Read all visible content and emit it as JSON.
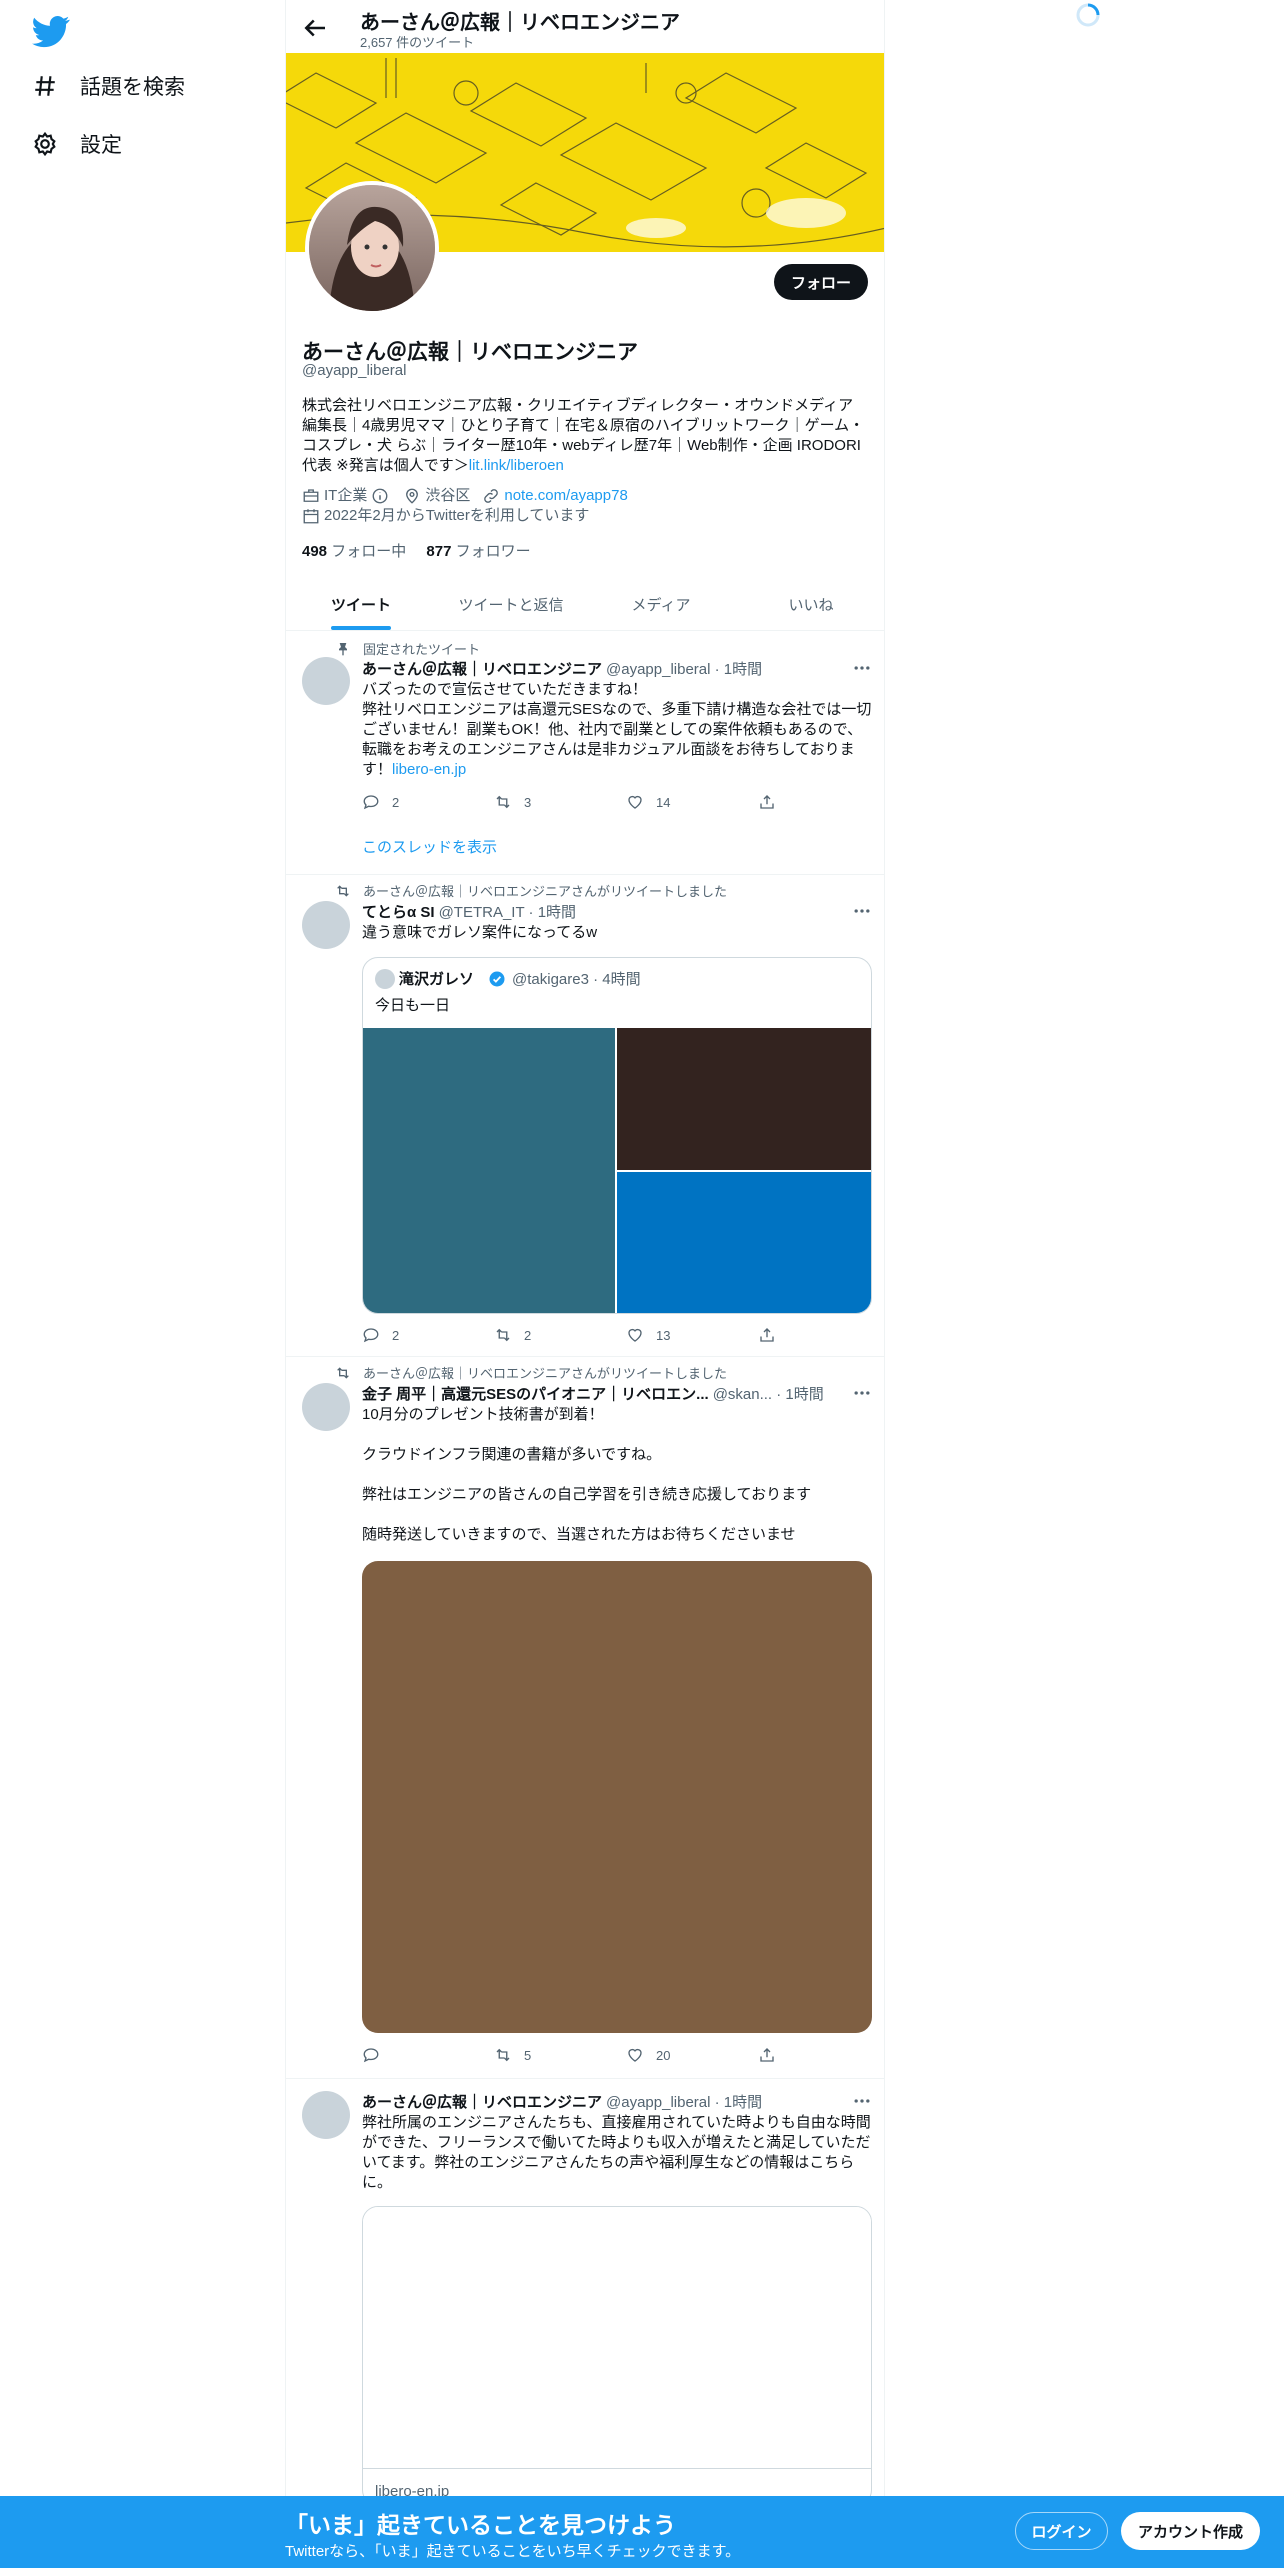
{
  "nav": {
    "items": [
      {
        "label": "話題を検索",
        "icon": "hashtag-icon"
      },
      {
        "label": "設定",
        "icon": "gear-icon"
      }
    ]
  },
  "header": {
    "title": "あーさん＠広報｜リベロエンジニア",
    "tweet_count": "2,657 件のツイート"
  },
  "profile": {
    "name": "あーさん＠広報｜リベロエンジニア",
    "handle": "@ayapp_liberal",
    "follow_label": "フォロー",
    "bio": "株式会社リベロエンジニア広報・クリエイティブディレクター・オウンドメディア編集長｜4歳男児ママ｜ひとり子育て｜在宅＆原宿のハイブリットワーク｜ゲーム・コスプレ・犬 らぶ｜ライター歴10年・webディレ歴7年｜Web制作・企画 IRODORI代表 ※発言は個人です＞",
    "bio_link": "lit.link/liberoen",
    "category": "IT企業",
    "location": "渋谷区",
    "website": "note.com/ayapp78",
    "joined": "2022年2月からTwitterを利用しています",
    "following_count": "498",
    "following_label": "フォロー中",
    "followers_count": "877",
    "followers_label": "フォロワー"
  },
  "tabs": [
    "ツイート",
    "ツイートと返信",
    "メディア",
    "いいね"
  ],
  "tweets": [
    {
      "social": "固定されたツイート",
      "name": "あーさん＠広報｜リベロエンジニア",
      "handle": "@ayapp_liberal · 1時間",
      "text": "バズったので宣伝させていただきますね！\n弊社リベロエンジニアは高還元SESなので、多重下請け構造な会社では一切ございません！副業もOK！他、社内で副業としての案件依頼もあるので、転職をお考えのエンジニアさんは是非カジュアル面談をお待ちしております！",
      "link": "libero-en.jp",
      "replies": "2",
      "retweets": "3",
      "likes": "14",
      "thread_label": "このスレッドを表示"
    },
    {
      "social": "あーさん＠広報｜リベロエンジニアさんがリツイートしました",
      "name": "てとらα SI",
      "handle": "@TETRA_IT · 1時間",
      "text": "違う意味でガレソ案件になってるw",
      "quote_name": "滝沢ガレソ",
      "quote_handle": "@takigare3 · 4時間",
      "quote_text": "今日も一日",
      "replies": "2",
      "retweets": "2",
      "likes": "13"
    },
    {
      "social": "あーさん＠広報｜リベロエンジニアさんがリツイートしました",
      "name": "金子 周平｜高還元SESのパイオニア｜リベロエン...",
      "handle": "@skan... · 1時間",
      "text": "10月分のプレゼント技術書が到着！\n\nクラウドインフラ関連の書籍が多いですね。\n\n弊社はエンジニアの皆さんの自己学習を引き続き応援しております\n\n随時発送していきますので、当選された方はお待ちくださいませ",
      "replies": "",
      "retweets": "5",
      "likes": "20"
    },
    {
      "name": "あーさん＠広報｜リベロエンジニア",
      "handle": "@ayapp_liberal · 1時間",
      "text": "弊社所属のエンジニアさんたちも、直接雇用されていた時よりも自由な時間ができた、フリーランスで働いてた時よりも収入が増えたと満足していただいてます。弊社のエンジニアさんたちの声や福利厚生などの情報はこちらに。",
      "card_domain": "libero-en.jp"
    }
  ],
  "bottom_bar": {
    "title": "「いま」起きていることを見つけよう",
    "subtitle": "Twitterなら、「いま」起きていることをいち早くチェックできます。",
    "login": "ログイン",
    "signup": "アカウント作成"
  },
  "colors": {
    "accent": "#1d9bf0",
    "banner_yellow": "#f5d90a",
    "media_teal": "#2e6b80",
    "media_dark": "#33231f",
    "media_blue": "#0073c2",
    "media_brown": "#7f5f42"
  }
}
